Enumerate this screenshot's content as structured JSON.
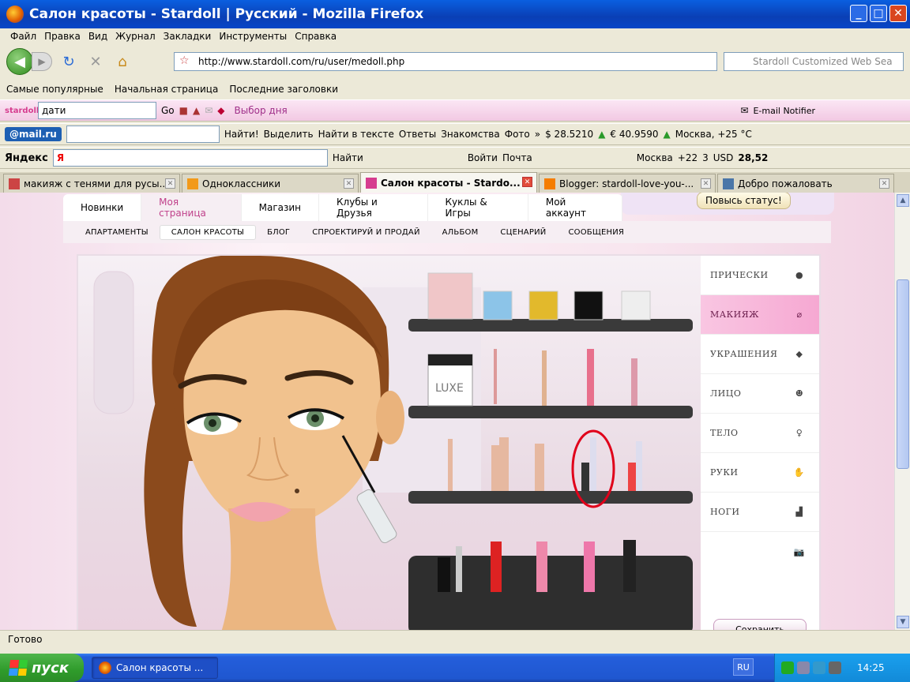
{
  "window": {
    "title": "Салон красоты - Stardoll | Русский - Mozilla Firefox"
  },
  "menu": [
    "Файл",
    "Правка",
    "Вид",
    "Журнал",
    "Закладки",
    "Инструменты",
    "Справка"
  ],
  "nav": {
    "url": "http://www.stardoll.com/ru/user/medoll.php",
    "search_placeholder": "Stardoll Customized Web Sea"
  },
  "bookmarks": [
    "Самые популярные",
    "Начальная страница",
    "Последние заголовки"
  ],
  "toolbar1": {
    "search_value": "дати",
    "go": "Go",
    "pick_of_day": "Выбор дня",
    "email_notifier": "E-mail Notifier"
  },
  "toolbar2": {
    "logo": "@mail.ru",
    "find": "Найти!",
    "highlight": "Выделить",
    "find_in_text": "Найти в тексте",
    "answers": "Ответы",
    "dating": "Знакомства",
    "photo": "Фото",
    "usd": "$ 28.5210",
    "eur": "€ 40.9590",
    "weather": "Москва, +25 °C"
  },
  "toolbar3": {
    "logo": "Яндекс",
    "find": "Найти",
    "login": "Войти",
    "mail": "Почта",
    "city": "Москва",
    "temp": "+22",
    "count": "3",
    "usd_label": "USD",
    "usd_value": "28,52"
  },
  "tabs": [
    {
      "label": "макияж с тенями для русы...",
      "active": false,
      "color": "#c44"
    },
    {
      "label": "Одноклассники",
      "active": false,
      "color": "#f29a1a"
    },
    {
      "label": "Салон красоты - Stardo...",
      "active": true,
      "color": "#d63d8f"
    },
    {
      "label": "Blogger: stardoll-love-you-...",
      "active": false,
      "color": "#f57d00"
    },
    {
      "label": "Добро пожаловать",
      "active": false,
      "color": "#4a76a8"
    }
  ],
  "site": {
    "status_button": "Повысь статус!",
    "main_nav": [
      "Новинки",
      "Моя страница",
      "Магазин",
      "Клубы и Друзья",
      "Куклы & Игры",
      "Мой аккаунт"
    ],
    "main_nav_active": "Моя страница",
    "sub_nav": [
      "АПАРТАМЕНТЫ",
      "САЛОН КРАСОТЫ",
      "БЛОГ",
      "СПРОЕКТИРУЙ И ПРОДАЙ",
      "АЛЬБОМ",
      "СЦЕНАРИЙ",
      "СООБЩЕНИЯ"
    ],
    "sub_nav_active": "САЛОН КРАСОТЫ",
    "categories": [
      "ПРИЧЕСКИ",
      "МАКИЯЖ",
      "УКРАШЕНИЯ",
      "ЛИЦО",
      "ТЕЛО",
      "РУКИ",
      "НОГИ"
    ],
    "categories_active": "МАКИЯЖ",
    "save_button": "Сохранить",
    "luxe_label": "LUXE"
  },
  "status": {
    "text": "Готово"
  },
  "taskbar": {
    "start": "пуск",
    "item": "Салон красоты ...",
    "lang": "RU",
    "time": "14:25"
  },
  "colors": {
    "accent_pink": "#d63d8f",
    "xp_blue": "#245edb",
    "highlight_red": "#e0001a"
  }
}
